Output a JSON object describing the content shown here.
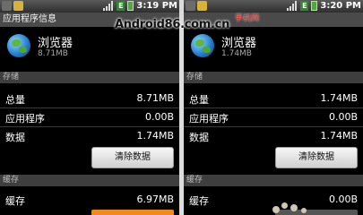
{
  "watermark": {
    "text": "Android86.com.cn",
    "cn": "手机网"
  },
  "left": {
    "status": {
      "time": "3:19 PM"
    },
    "title": "应用程序信息",
    "app": {
      "name": "浏览器",
      "size": "8.71MB"
    },
    "storage": {
      "header": "存储",
      "rows": [
        {
          "label": "总量",
          "value": "8.71MB"
        },
        {
          "label": "应用程序",
          "value": "0.00B"
        },
        {
          "label": "数据",
          "value": "1.74MB"
        }
      ],
      "clear_label": "清除数据"
    },
    "cache": {
      "header": "缓存",
      "rows": [
        {
          "label": "缓存",
          "value": "6.97MB"
        }
      ]
    }
  },
  "right": {
    "status": {
      "time": "3:20 PM"
    },
    "app": {
      "name": "浏览器",
      "size": "1.74MB"
    },
    "storage": {
      "header": "存储",
      "rows": [
        {
          "label": "总量",
          "value": "1.74MB"
        },
        {
          "label": "应用程序",
          "value": "0.00B"
        },
        {
          "label": "数据",
          "value": "1.74MB"
        }
      ],
      "clear_label": "清除数据"
    },
    "cache": {
      "header": "缓存",
      "rows": [
        {
          "label": "缓存",
          "value": "0.00B"
        }
      ]
    }
  },
  "colors": {
    "accent": "#f08a1c",
    "battery": "#4ea83a"
  }
}
